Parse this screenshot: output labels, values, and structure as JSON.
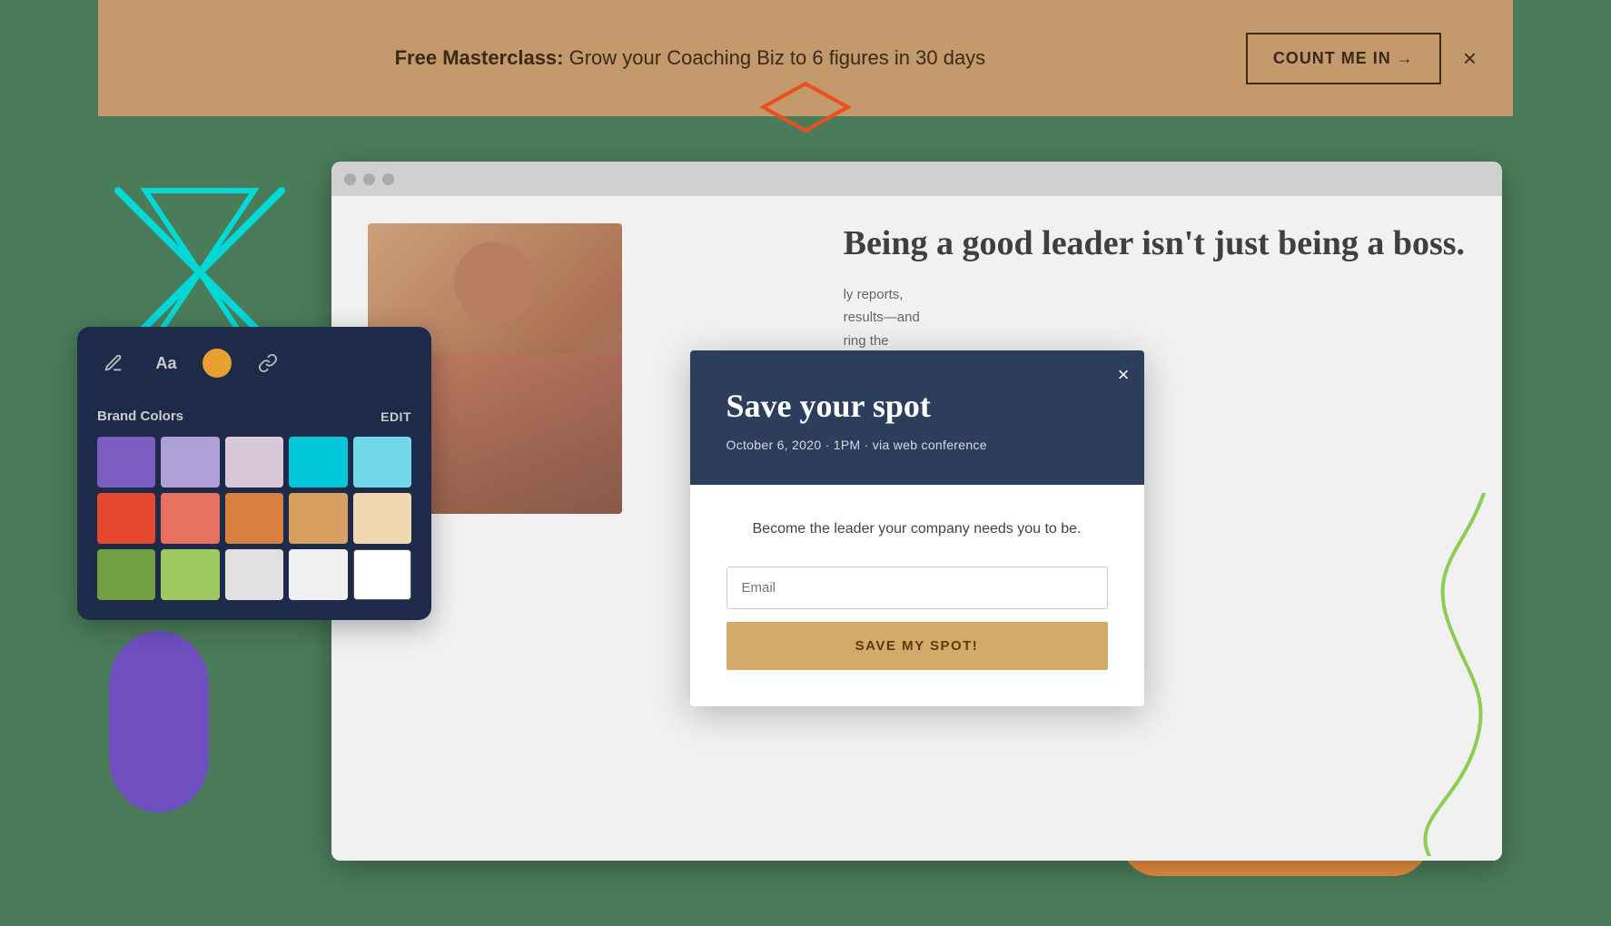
{
  "announcement": {
    "text_before": "Free Masterclass:",
    "text_after": " Grow your Coaching Biz to 6 figures in 30 days",
    "cta_label": "COUNT ME IN →",
    "close_label": "×"
  },
  "browser": {
    "website": {
      "heading": "Being a good leader isn't just being a boss.",
      "body": "ly reports, results—and ring the nlearn old and ou identify rt gett..."
    }
  },
  "modal": {
    "title": "Save your spot",
    "subtitle": "October 6, 2020 · 1PM · via web conference",
    "description": "Become the leader your company needs you to be.",
    "email_placeholder": "Email",
    "submit_label": "SAVE MY SPOT!",
    "close_label": "×"
  },
  "brand_panel": {
    "colors_label": "Brand Colors",
    "edit_label": "EDIT",
    "toolbar": {
      "pen_icon": "✏",
      "text_icon": "Aa",
      "link_icon": "🔗"
    },
    "swatches": [
      "#7c5cbf",
      "#b0a0d8",
      "#d8c8d8",
      "#00c8d8",
      "#70d8e8",
      "#e84830",
      "#e87060",
      "#d88040",
      "#d8a060",
      "#f0d8b0",
      "#70a040",
      "#a0c860",
      "#e0e0e0",
      "#f0f0f0",
      "#ffffff"
    ]
  },
  "icons": {
    "diamond_color": "#e85020",
    "hourglass_color": "#00d8d8",
    "squiggle_color": "#80c840",
    "purple_blob_color": "#7050c0",
    "orange_pill_color": "#e89040"
  }
}
